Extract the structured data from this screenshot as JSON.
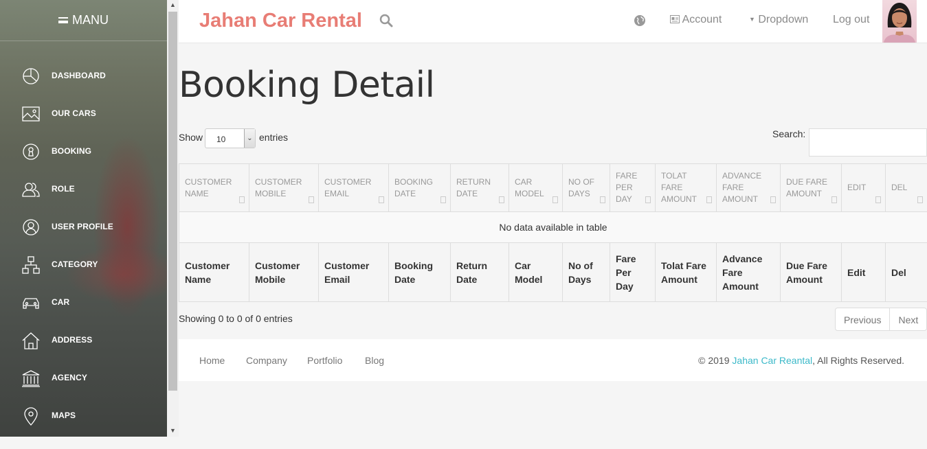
{
  "sidebar": {
    "menu_label": "MANU",
    "items": [
      {
        "label": "DASHBOARD",
        "icon": "pie-chart-icon"
      },
      {
        "label": "OUR CARS",
        "icon": "image-icon"
      },
      {
        "label": "BOOKING",
        "icon": "keyhole-icon"
      },
      {
        "label": "ROLE",
        "icon": "users-icon"
      },
      {
        "label": "USER PROFILE",
        "icon": "user-circle-icon"
      },
      {
        "label": "CATEGORY",
        "icon": "sitemap-icon"
      },
      {
        "label": "CAR",
        "icon": "car-icon"
      },
      {
        "label": "ADDRESS",
        "icon": "home-icon"
      },
      {
        "label": "AGENCY",
        "icon": "bank-icon"
      },
      {
        "label": "MAPS",
        "icon": "map-pin-icon"
      }
    ]
  },
  "header": {
    "brand": "Jahan Car Rental",
    "account": "Account",
    "dropdown": "Dropdown",
    "logout": "Log out"
  },
  "page": {
    "title": "Booking Detail",
    "show_label": "Show",
    "entries_label": "entries",
    "page_size": "10",
    "search_label": "Search:"
  },
  "table": {
    "head_columns": [
      "CUSTOMER NAME",
      "CUSTOMER MOBILE",
      "CUSTOMER EMAIL",
      "BOOKING DATE",
      "RETURN DATE",
      "CAR MODEL",
      "NO OF DAYS",
      "FARE PER DAY",
      "TOLAT FARE AMOUNT",
      "ADVANCE FARE AMOUNT",
      "DUE FARE AMOUNT",
      "EDIT",
      "DEL"
    ],
    "foot_columns": [
      "Customer Name",
      "Customer Mobile",
      "Customer Email",
      "Booking Date",
      "Return Date",
      "Car Model",
      "No of Days",
      "Fare Per Day",
      "Tolat Fare Amount",
      "Advance Fare Amount",
      "Due Fare Amount",
      "Edit",
      "Del"
    ],
    "empty_message": "No data available in table"
  },
  "pagination": {
    "info": "Showing 0 to 0 of 0 entries",
    "previous": "Previous",
    "next": "Next"
  },
  "footer": {
    "links": [
      "Home",
      "Company",
      "Portfolio",
      "Blog"
    ],
    "copyright_prefix": "© 2019 ",
    "copyright_brand": "Jahan Car Reantal",
    "copyright_suffix": ", All Rights Reserved."
  },
  "colors": {
    "brand": "#e87d75",
    "link_accent": "#3bb9c9"
  }
}
